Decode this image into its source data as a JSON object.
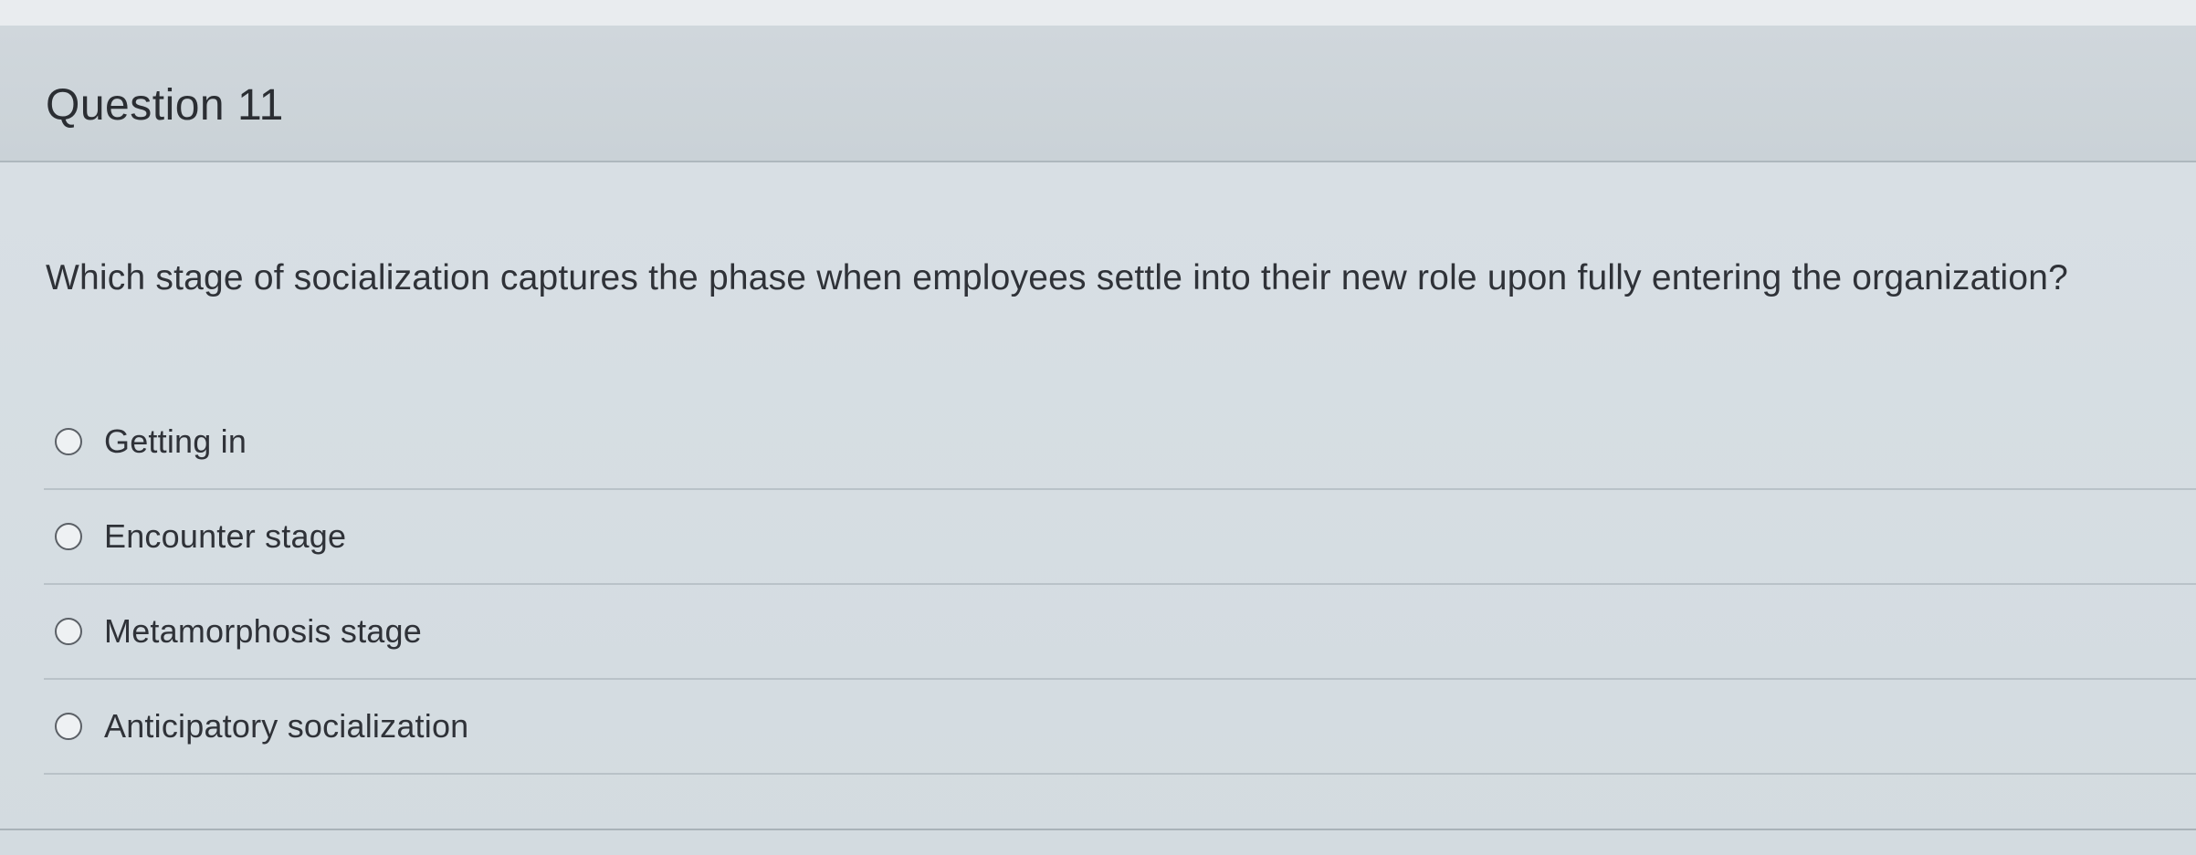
{
  "question": {
    "title": "Question 11",
    "prompt": "Which stage of socialization captures the phase when employees settle into their new role upon fully entering the organization?",
    "options": [
      {
        "label": "Getting in",
        "selected": false
      },
      {
        "label": "Encounter stage",
        "selected": false
      },
      {
        "label": "Metamorphosis stage",
        "selected": false
      },
      {
        "label": "Anticipatory socialization",
        "selected": false
      }
    ]
  },
  "icons": {
    "radio": "radio-circle-unselected"
  },
  "colors": {
    "background": "#d5dde2",
    "header": "#cad2d7",
    "text": "#2f3238",
    "radio_border": "#5b6066"
  }
}
